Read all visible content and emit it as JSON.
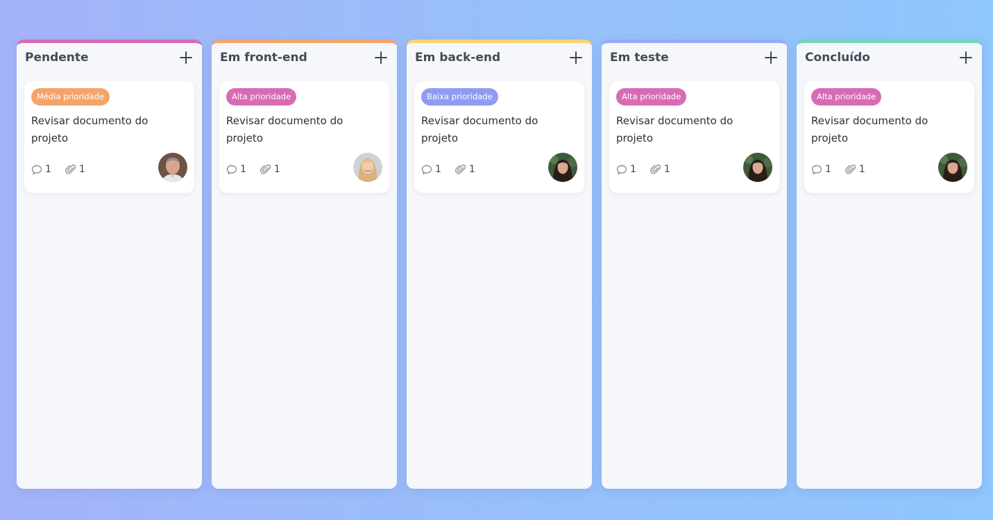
{
  "colors": {
    "pendente": "#d86bb5",
    "front": "#f4a46a",
    "back": "#f7d66b",
    "teste": "#9aa8f5",
    "concluido": "#6fd6bd",
    "badge_media": "#f4a46a",
    "badge_alta": "#d86bb5",
    "badge_baixa": "#8f9cf2"
  },
  "columns": [
    {
      "title": "Pendente",
      "card": {
        "badge": "Média prioridade",
        "title": "Revisar documento do projeto",
        "comments": "1",
        "attachments": "1",
        "avatar_icon": "avatar-man-icon"
      }
    },
    {
      "title": "Em front-end",
      "card": {
        "badge": "Alta prioridade",
        "title": "Revisar documento do projeto",
        "comments": "1",
        "attachments": "1",
        "avatar_icon": "avatar-blonde-woman-icon"
      }
    },
    {
      "title": "Em back-end",
      "card": {
        "badge": "Baixa prioridade",
        "title": "Revisar documento do projeto",
        "comments": "1",
        "attachments": "1",
        "avatar_icon": "avatar-woman-icon"
      }
    },
    {
      "title": "Em teste",
      "card": {
        "badge": "Alta prioridade",
        "title": "Revisar documento do projeto",
        "comments": "1",
        "attachments": "1",
        "avatar_icon": "avatar-woman-icon"
      }
    },
    {
      "title": "Concluído",
      "card": {
        "badge": "Alta prioridade",
        "title": "Revisar documento do projeto",
        "comments": "1",
        "attachments": "1",
        "avatar_icon": "avatar-woman-icon"
      }
    }
  ]
}
